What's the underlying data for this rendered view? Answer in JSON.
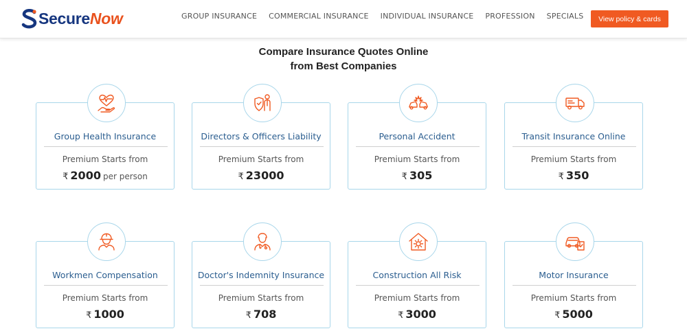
{
  "header": {
    "logo_secure": "Secure",
    "logo_now": "Now",
    "nav": [
      "GROUP INSURANCE",
      "COMMERCIAL INSURANCE",
      "INDIVIDUAL INSURANCE",
      "PROFESSION",
      "SPECIALS"
    ],
    "cta_label": "View policy & cards"
  },
  "headline": {
    "line1": "Compare Insurance Quotes Online",
    "line2": "from Best Companies"
  },
  "colors": {
    "brand_blue": "#16367f",
    "brand_orange": "#f05a22",
    "card_border": "#a8d6ea",
    "title_blue": "#2a5d8f"
  },
  "currency_symbol": "₹",
  "cards": [
    {
      "icon": "heart-hand-icon",
      "title": "Group Health Insurance",
      "label": "Premium Starts from",
      "amount": "2000",
      "unit": "per person"
    },
    {
      "icon": "director-shield-icon",
      "title": "Directors & Officers Liability",
      "label": "Premium Starts from",
      "amount": "23000",
      "unit": ""
    },
    {
      "icon": "accident-car-icon",
      "title": "Personal Accident",
      "label": "Premium Starts from",
      "amount": "305",
      "unit": ""
    },
    {
      "icon": "truck-icon",
      "title": "Transit Insurance Online",
      "label": "Premium Starts from",
      "amount": "350",
      "unit": ""
    },
    {
      "icon": "worker-helmet-icon",
      "title": "Workmen Compensation",
      "label": "Premium Starts from",
      "amount": "1000",
      "unit": ""
    },
    {
      "icon": "doctor-icon",
      "title": "Doctor's Indemnity Insurance",
      "label": "Premium Starts from",
      "amount": "708",
      "unit": ""
    },
    {
      "icon": "construction-gear-icon",
      "title": "Construction All Risk",
      "label": "Premium Starts from",
      "amount": "3000",
      "unit": ""
    },
    {
      "icon": "motor-car-icon",
      "title": "Motor Insurance",
      "label": "Premium Starts from",
      "amount": "5000",
      "unit": ""
    }
  ]
}
